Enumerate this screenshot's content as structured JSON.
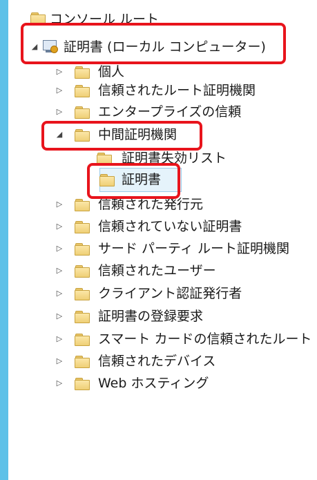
{
  "tree": {
    "root_label": "コンソール ルート",
    "cert_store_label": "証明書 (ローカル コンピューター)",
    "items": [
      {
        "label": "個人"
      },
      {
        "label": "信頼されたルート証明機関"
      },
      {
        "label": "エンタープライズの信頼"
      },
      {
        "label": "中間証明機関"
      },
      {
        "label": "証明書失効リスト"
      },
      {
        "label": "証明書"
      },
      {
        "label": "信頼された発行元"
      },
      {
        "label": "信頼されていない証明書"
      },
      {
        "label": "サード パーティ ルート証明機関"
      },
      {
        "label": "信頼されたユーザー"
      },
      {
        "label": "クライアント認証発行者"
      },
      {
        "label": "証明書の登録要求"
      },
      {
        "label": "スマート カードの信頼されたルート"
      },
      {
        "label": "信頼されたデバイス"
      },
      {
        "label": "Web ホスティング"
      }
    ]
  },
  "colors": {
    "highlight": "#e8141c",
    "left_strip": "#5ec1e8",
    "selection_bg": "#e5f3fb",
    "folder": "#efcf76"
  },
  "icons": {
    "expander_collapsed": "triangle-right-icon",
    "expander_expanded": "triangle-down-icon",
    "folder": "folder-icon",
    "cert_store": "certificate-store-icon"
  }
}
